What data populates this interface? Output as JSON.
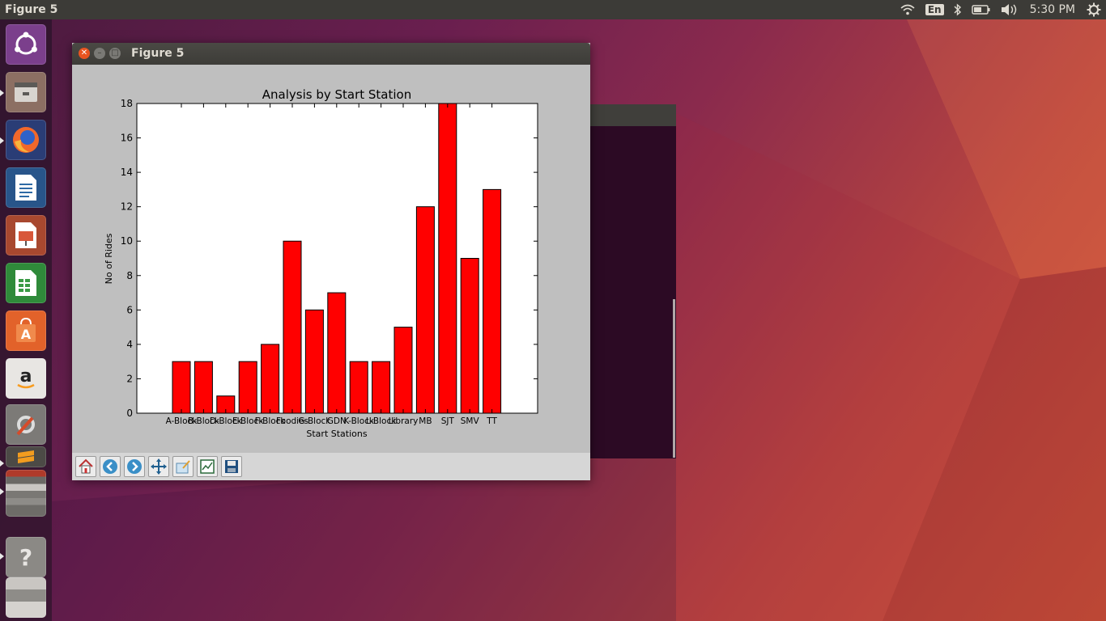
{
  "top_panel": {
    "app_title": "Figure 5",
    "keyboard_layout": "En",
    "clock": "5:30 PM"
  },
  "launcher": {
    "items": [
      "ubuntu-dash",
      "files",
      "firefox",
      "writer",
      "impress",
      "calc",
      "software-center",
      "amazon",
      "system-settings",
      "sublime-text",
      "stacked-apps",
      "help",
      "stacked-apps-2"
    ]
  },
  "window": {
    "title": "Figure 5"
  },
  "toolbar": {
    "buttons": [
      "home",
      "back",
      "forward",
      "pan",
      "zoom",
      "configure-subplots",
      "save"
    ]
  },
  "colors": {
    "bar": "#ff0000",
    "panel": "#3c3b37",
    "figure_bg": "#bfbfbf"
  },
  "chart_data": {
    "type": "bar",
    "title": "Analysis by Start Station",
    "xlabel": "Start Stations",
    "ylabel": "No of Rides",
    "categories": [
      "A-Block",
      "B-Block",
      "D-Block",
      "E-Block",
      "F-Block",
      "Foodies",
      "G-Block",
      "GDN",
      "K-Block",
      "L-Block",
      "Library",
      "MB",
      "SJT",
      "SMV",
      "TT"
    ],
    "values": [
      3,
      3,
      1,
      3,
      4,
      10,
      6,
      7,
      3,
      3,
      5,
      12,
      18,
      9,
      13
    ],
    "yticks": [
      0,
      2,
      4,
      6,
      8,
      10,
      12,
      14,
      16,
      18
    ],
    "ylim": [
      0,
      18
    ],
    "grid": false
  }
}
